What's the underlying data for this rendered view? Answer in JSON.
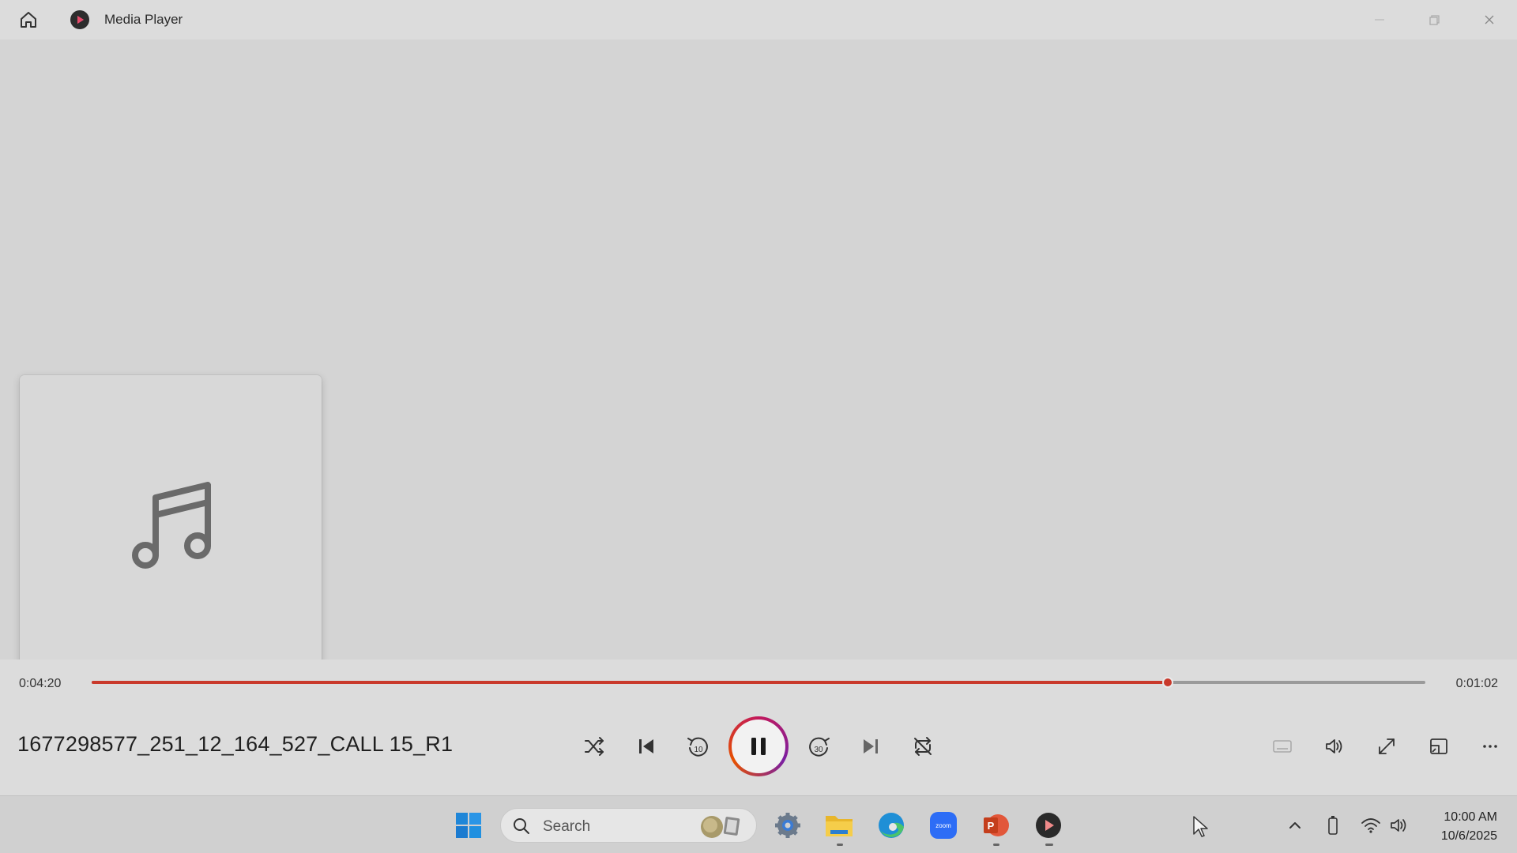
{
  "window": {
    "title": "Media Player",
    "controls": [
      "minimize",
      "maximize",
      "close"
    ]
  },
  "playback": {
    "elapsed": "0:04:20",
    "remaining": "0:01:02",
    "progress_fraction": 0.807,
    "track_title": "1677298577_251_12_164_527_CALL 15_R1",
    "state": "playing",
    "accent_color": "#c9392b"
  },
  "controls": {
    "shuffle": "shuffle-icon",
    "previous": "previous-icon",
    "rewind": "rewind-10-icon",
    "rewind_label": "10",
    "play_pause": "pause-icon",
    "forward": "forward-30-icon",
    "forward_label": "30",
    "next": "next-icon",
    "repeat": "repeat-off-icon",
    "right": [
      "captions-icon",
      "volume-icon",
      "fullscreen-icon",
      "mini-player-icon",
      "more-icon"
    ]
  },
  "taskbar": {
    "search_placeholder": "Search",
    "apps": [
      "start",
      "search",
      "settings",
      "file-explorer",
      "edge",
      "zoom",
      "powerpoint",
      "media-player"
    ],
    "zoom_label": "zoom",
    "powerpoint_label": "P",
    "clock_time": "10:00 AM",
    "clock_date": "10/6/2025"
  }
}
